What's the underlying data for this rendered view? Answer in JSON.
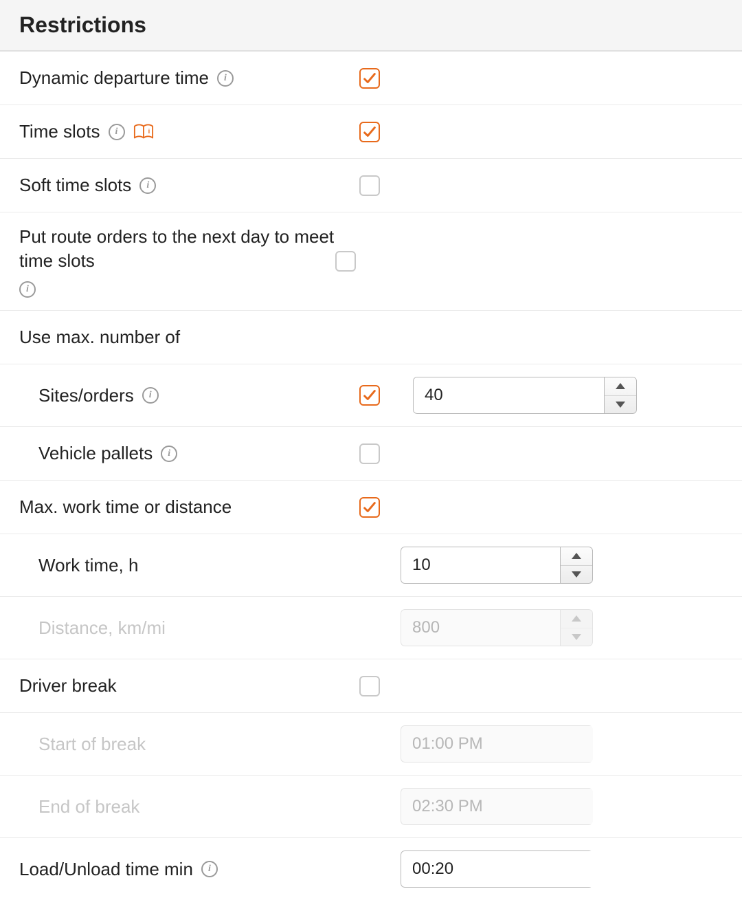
{
  "header": {
    "title": "Restrictions"
  },
  "rows": {
    "dynamic_departure": {
      "label": "Dynamic departure time",
      "checked": true
    },
    "time_slots": {
      "label": "Time slots",
      "checked": true
    },
    "soft_time_slots": {
      "label": "Soft time slots",
      "checked": false
    },
    "next_day": {
      "label": "Put route orders to the next day to meet time slots",
      "checked": false
    },
    "use_max": {
      "label": "Use max. number of"
    },
    "sites_orders": {
      "label": "Sites/orders",
      "checked": true,
      "value": "40"
    },
    "vehicle_pallets": {
      "label": "Vehicle pallets",
      "checked": false
    },
    "max_work": {
      "label": "Max. work time or distance",
      "checked": true
    },
    "work_time": {
      "label": "Work time, h",
      "value": "10"
    },
    "distance": {
      "label": "Distance, km/mi",
      "value": "800"
    },
    "driver_break": {
      "label": "Driver break",
      "checked": false
    },
    "start_break": {
      "label": "Start of break",
      "value": "01:00 PM"
    },
    "end_break": {
      "label": "End of break",
      "value": "02:30 PM"
    },
    "load_unload": {
      "label": "Load/Unload time min",
      "value": "00:20"
    }
  }
}
